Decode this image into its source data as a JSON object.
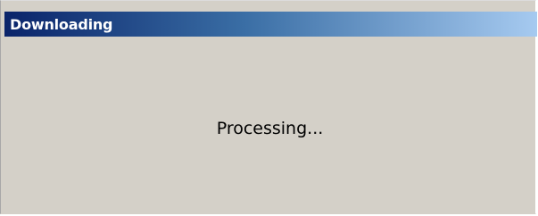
{
  "window": {
    "title": "Downloading"
  },
  "main": {
    "status_text": "Processing..."
  },
  "colors": {
    "titlebar_start": "#0a246a",
    "titlebar_end": "#a6caf0",
    "dialog_background": "#d4d0c8",
    "title_text": "#ffffff",
    "body_text": "#000000"
  }
}
